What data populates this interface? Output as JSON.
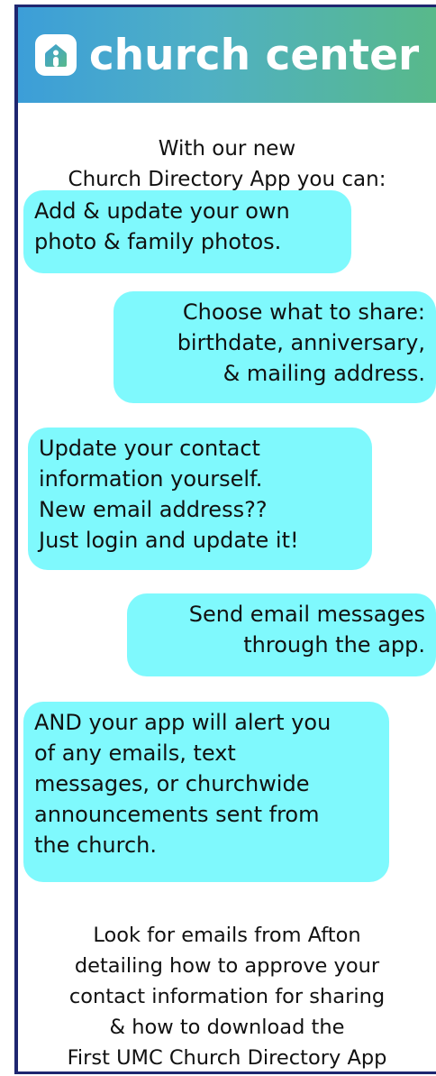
{
  "header": {
    "brand": "church center",
    "icon": "church-house-icon",
    "colors": {
      "from": "#3c9ed8",
      "to": "#58b98a"
    }
  },
  "intro": {
    "line1": "With our new",
    "line2": "Church Directory App you can:"
  },
  "features": [
    {
      "text": "Add & update your own\nphoto & family photos."
    },
    {
      "text": "Choose what to share:\nbirthdate, anniversary,\n& mailing address."
    },
    {
      "text": "Update your contact\ninformation yourself.\nNew email address??\nJust login and update it!"
    },
    {
      "text": "Send email messages\nthrough the app."
    },
    {
      "text": "AND your app will alert you\nof any emails, text\nmessages, or churchwide\nannouncements sent from\nthe church."
    }
  ],
  "footer": {
    "line1": "Look for emails from Afton",
    "line2": "detailing how to approve your",
    "line3": "contact information for sharing",
    "line4": "& how to download the",
    "line5": "First UMC Church Directory App"
  },
  "colors": {
    "bubble": "#7ff9fd",
    "frame": "#1f2670"
  }
}
